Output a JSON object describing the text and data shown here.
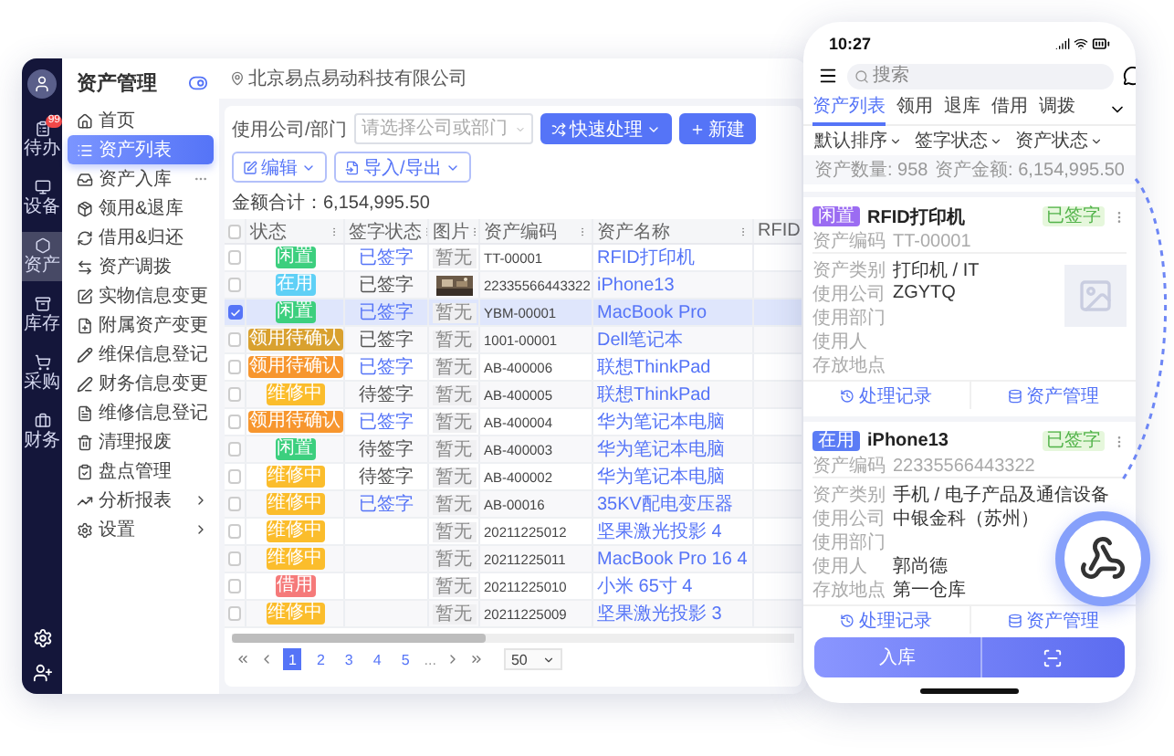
{
  "rail": {
    "items": [
      {
        "label": "待办",
        "selected": false,
        "badge": "99"
      },
      {
        "label": "设备",
        "selected": false
      },
      {
        "label": "资产",
        "selected": true
      },
      {
        "label": "库存",
        "selected": false
      },
      {
        "label": "采购",
        "selected": false
      },
      {
        "label": "财务",
        "selected": false
      }
    ]
  },
  "sidebar": {
    "title": "资产管理",
    "items": [
      {
        "label": "首页",
        "kind": "page",
        "selected": false
      },
      {
        "label": "资产列表",
        "kind": "page",
        "selected": true
      },
      {
        "label": "资产入库",
        "kind": "more",
        "selected": false
      },
      {
        "label": "领用&退库",
        "kind": "page",
        "selected": false
      },
      {
        "label": "借用&归还",
        "kind": "page",
        "selected": false
      },
      {
        "label": "资产调拨",
        "kind": "page",
        "selected": false
      },
      {
        "label": "实物信息变更",
        "kind": "page",
        "selected": false
      },
      {
        "label": "附属资产变更",
        "kind": "page",
        "selected": false
      },
      {
        "label": "维保信息登记",
        "kind": "page",
        "selected": false
      },
      {
        "label": "财务信息变更",
        "kind": "page",
        "selected": false
      },
      {
        "label": "维修信息登记",
        "kind": "page",
        "selected": false
      },
      {
        "label": "清理报废",
        "kind": "page",
        "selected": false
      },
      {
        "label": "盘点管理",
        "kind": "page",
        "selected": false
      },
      {
        "label": "分析报表",
        "kind": "menu",
        "selected": false
      },
      {
        "label": "设置",
        "kind": "menu",
        "selected": false
      }
    ]
  },
  "top_bar": {
    "company": "北京易点易动科技有限公司"
  },
  "toolbar": {
    "filter_label": "使用公司/部门",
    "select": {
      "placeholder": "请选择公司或部门"
    },
    "buttons": [
      {
        "label": "快速处理",
        "kind": "primary",
        "dropdown": true
      },
      {
        "label": "新建",
        "kind": "primary",
        "dropdown": false
      },
      {
        "label": "编辑",
        "kind": "outline",
        "dropdown": true
      },
      {
        "label": "导入/导出",
        "kind": "outline",
        "dropdown": true
      }
    ]
  },
  "total": "金额合计：6,154,995.50",
  "table": {
    "select_all": false,
    "columns": [
      "状态",
      "签字状态",
      "图片",
      "资产编码",
      "资产名称",
      "RFID"
    ],
    "rows": [
      {
        "checked": false,
        "status": {
          "text": "闲置",
          "color": "#3ccf7e"
        },
        "sign": {
          "text": "已签字",
          "linked": true
        },
        "image": {
          "kind": "placeholder",
          "text": "暂无"
        },
        "code": "TT-00001",
        "name": "RFID打印机"
      },
      {
        "checked": false,
        "status": {
          "text": "在用",
          "color": "#5fd0f6"
        },
        "sign": {
          "text": "已签字",
          "linked": false
        },
        "code": "22335566443322",
        "name": "iPhone13"
      },
      {
        "checked": true,
        "status": {
          "text": "闲置",
          "color": "#3ccf7e"
        },
        "sign": {
          "text": "已签字",
          "linked": true
        },
        "image": {
          "kind": "placeholder",
          "text": "暂无"
        },
        "code": "YBM-00001",
        "name": "MacBook Pro"
      },
      {
        "checked": false,
        "status": {
          "text": "领用待确认",
          "color": "#d9a12f"
        },
        "sign": {
          "text": "已签字",
          "linked": false
        },
        "image": {
          "kind": "placeholder",
          "text": "暂无"
        },
        "code": "1001-00001",
        "name": "Dell笔记本"
      },
      {
        "checked": false,
        "status": {
          "text": "领用待确认",
          "color": "#f7962e"
        },
        "sign": {
          "text": "已签字",
          "linked": true
        },
        "image": {
          "kind": "placeholder",
          "text": "暂无"
        },
        "code": "AB-400006",
        "name": "联想ThinkPad"
      },
      {
        "checked": false,
        "status": {
          "text": "维修中",
          "color": "#fbbd2c"
        },
        "sign": {
          "text": "待签字",
          "linked": false
        },
        "image": {
          "kind": "placeholder",
          "text": "暂无"
        },
        "code": "AB-400005",
        "name": "联想ThinkPad"
      },
      {
        "checked": false,
        "status": {
          "text": "领用待确认",
          "color": "#f7962e"
        },
        "sign": {
          "text": "已签字",
          "linked": true
        },
        "image": {
          "kind": "placeholder",
          "text": "暂无"
        },
        "code": "AB-400004",
        "name": "华为笔记本电脑"
      },
      {
        "checked": false,
        "status": {
          "text": "闲置",
          "color": "#3ccf7e"
        },
        "sign": {
          "text": "待签字",
          "linked": false
        },
        "image": {
          "kind": "placeholder",
          "text": "暂无"
        },
        "code": "AB-400003",
        "name": "华为笔记本电脑"
      },
      {
        "checked": false,
        "status": {
          "text": "维修中",
          "color": "#fbbd2c"
        },
        "sign": {
          "text": "待签字",
          "linked": false
        },
        "image": {
          "kind": "placeholder",
          "text": "暂无"
        },
        "code": "AB-400002",
        "name": "华为笔记本电脑"
      },
      {
        "checked": false,
        "status": {
          "text": "维修中",
          "color": "#fbbd2c"
        },
        "sign": {
          "text": "已签字",
          "linked": true
        },
        "image": {
          "kind": "placeholder",
          "text": "暂无"
        },
        "code": "AB-00016",
        "name": "35KV配电变压器"
      },
      {
        "checked": false,
        "status": {
          "text": "维修中",
          "color": "#fbbd2c"
        },
        "image": {
          "kind": "placeholder",
          "text": "暂无"
        },
        "code": "20211225012",
        "name": "坚果激光投影 4"
      },
      {
        "checked": false,
        "status": {
          "text": "维修中",
          "color": "#fbbd2c"
        },
        "image": {
          "kind": "placeholder",
          "text": "暂无"
        },
        "code": "20211225011",
        "name": "MacBook Pro 16 4"
      },
      {
        "checked": false,
        "status": {
          "text": "借用",
          "color": "#f57a7a"
        },
        "image": {
          "kind": "placeholder",
          "text": "暂无"
        },
        "code": "20211225010",
        "name": "小米 65寸 4"
      },
      {
        "checked": false,
        "status": {
          "text": "维修中",
          "color": "#fbbd2c"
        },
        "image": {
          "kind": "placeholder",
          "text": "暂无"
        },
        "code": "20211225009",
        "name": "坚果激光投影 3"
      }
    ]
  },
  "pagination": {
    "pages": [
      {
        "label": "1",
        "selected": true
      },
      {
        "label": "2",
        "selected": false
      },
      {
        "label": "3",
        "selected": false
      },
      {
        "label": "4",
        "selected": false
      },
      {
        "label": "5",
        "selected": false
      }
    ],
    "ellipsis": "...",
    "page_size": "50"
  },
  "phone": {
    "time": "10:27",
    "search": {
      "placeholder": "搜索"
    },
    "tabs": [
      {
        "label": "资产列表",
        "selected": true
      },
      {
        "label": "领用",
        "selected": false
      },
      {
        "label": "退库",
        "selected": false
      },
      {
        "label": "借用",
        "selected": false
      },
      {
        "label": "调拨",
        "selected": false
      }
    ],
    "filters": [
      "默认排序",
      "签字状态",
      "资产状态"
    ],
    "count": "资产数量: 958",
    "amount": "资产金额: 6,154,995.50",
    "cards": [
      {
        "tag": {
          "text": "闲置",
          "color": "#9b6cf2"
        },
        "name": "RFID打印机",
        "badge": "已签字",
        "code_label": "资产编码",
        "code": "TT-00001",
        "has_image": true,
        "fields": [
          {
            "label": "资产类别",
            "value": "打印机 / IT"
          },
          {
            "label": "使用公司",
            "value": "ZGYTQ"
          },
          {
            "label": "使用部门"
          },
          {
            "label": "使用人"
          },
          {
            "label": "存放地点"
          }
        ],
        "actions": [
          "处理记录",
          "资产管理"
        ]
      },
      {
        "tag": {
          "text": "在用",
          "color": "#5b7cf5"
        },
        "name": "iPhone13",
        "badge": "已签字",
        "code_label": "资产编码",
        "code": "22335566443322",
        "has_image": false,
        "fields": [
          {
            "label": "资产类别",
            "value": "手机 / 电子产品及通信设备"
          },
          {
            "label": "使用公司",
            "value": "中银金科（苏州）"
          },
          {
            "label": "使用部门"
          },
          {
            "label": "使用人",
            "value": "郭尚德"
          },
          {
            "label": "存放地点",
            "value": "第一仓库"
          }
        ],
        "actions": [
          "处理记录",
          "资产管理"
        ]
      }
    ],
    "primary_action": "入库"
  }
}
